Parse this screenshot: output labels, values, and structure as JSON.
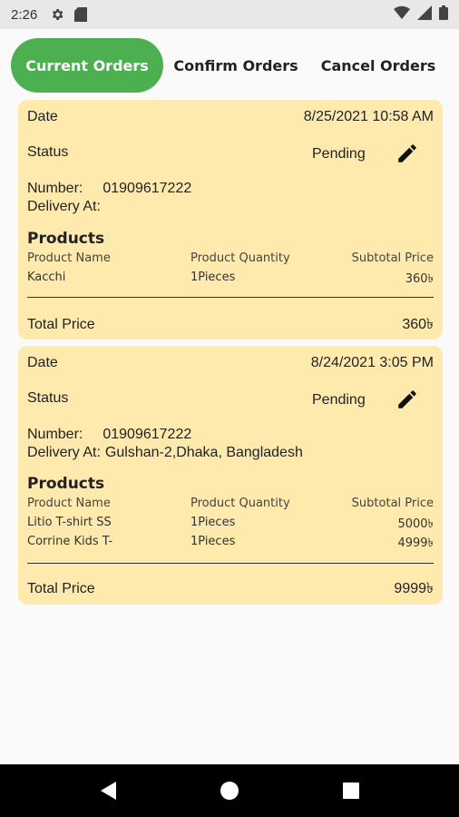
{
  "status_bar": {
    "time": "2:26",
    "icons": [
      "gear-icon",
      "sd-card-icon",
      "wifi-icon",
      "signal-icon",
      "battery-icon"
    ]
  },
  "tabs": [
    {
      "label": "Current Orders",
      "active": true
    },
    {
      "label": "Confirm Orders",
      "active": false
    },
    {
      "label": "Cancel Orders",
      "active": false
    }
  ],
  "colors": {
    "accent": "#4caf50",
    "card_bg": "#ffeaad",
    "page_bg": "#fafafa"
  },
  "orders": [
    {
      "date_label": "Date",
      "date": "8/25/2021 10:58 AM",
      "status_label": "Status",
      "status": "Pending",
      "number_label": "Number:",
      "number": "01909617222",
      "delivery_label": "Delivery At:",
      "delivery": "",
      "products_title": "Products",
      "columns": [
        "Product Name",
        "Product Quantity",
        "Subtotal Price"
      ],
      "items": [
        {
          "name": "Kacchi",
          "qty": "1Pieces",
          "subtotal": "360৳"
        }
      ],
      "total_label": "Total Price",
      "total": "360৳"
    },
    {
      "date_label": "Date",
      "date": "8/24/2021 3:05 PM",
      "status_label": "Status",
      "status": "Pending",
      "number_label": "Number:",
      "number": "01909617222",
      "delivery_label": "Delivery At:",
      "delivery": "Gulshan-2,Dhaka, Bangladesh",
      "products_title": "Products",
      "columns": [
        "Product Name",
        "Product Quantity",
        "Subtotal Price"
      ],
      "items": [
        {
          "name": "Litio T-shirt SS",
          "qty": "1Pieces",
          "subtotal": "5000৳"
        },
        {
          "name": "Corrine Kids T-",
          "qty": "1Pieces",
          "subtotal": "4999৳"
        }
      ],
      "total_label": "Total Price",
      "total": "9999৳"
    }
  ]
}
